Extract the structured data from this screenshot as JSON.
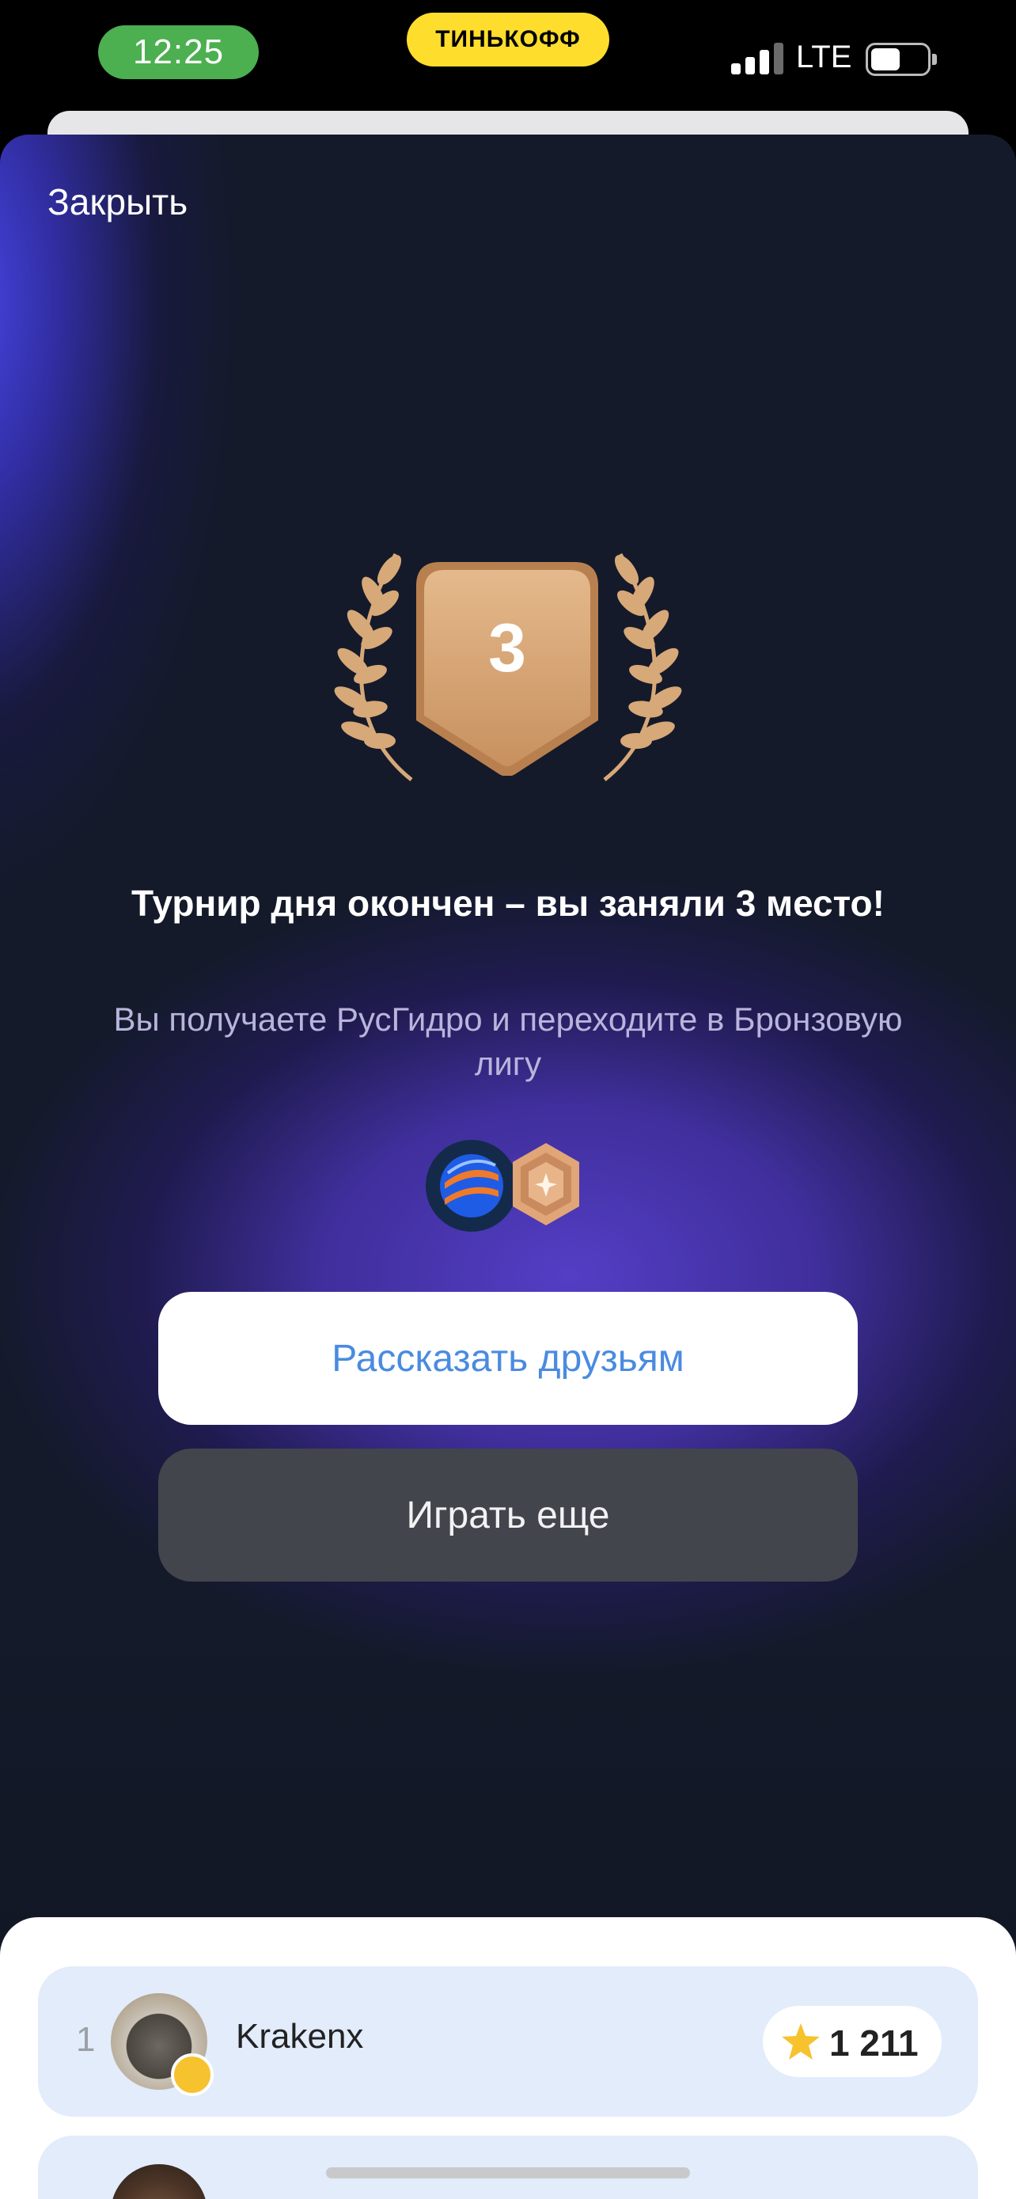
{
  "status_bar": {
    "time": "12:25",
    "carrier_badge": "ТИНЬКОФФ",
    "network": "LTE",
    "signal_bars": 3,
    "battery_level": 0.45
  },
  "modal": {
    "close_label": "Закрыть",
    "place_number": "3",
    "headline": "Турнир дня окончен – вы заняли 3 место!",
    "subtitle": "Вы получаете РусГидро и переходите в Бронзовую лигу",
    "share_button": "Рассказать друзьям",
    "play_button": "Играть еще"
  },
  "leaderboard": {
    "rows": [
      {
        "rank": "1",
        "name": "Krakenx",
        "score": "1 211",
        "icon": "star-icon"
      },
      {
        "rank": "",
        "name": "",
        "score": "",
        "icon": "star-icon"
      }
    ]
  },
  "colors": {
    "brand_yellow": "#ffdd2d",
    "time_pill": "#4caf50",
    "accent_blue": "#4a8be0",
    "bronze": "#d4a373",
    "purple": "#5740cd"
  }
}
